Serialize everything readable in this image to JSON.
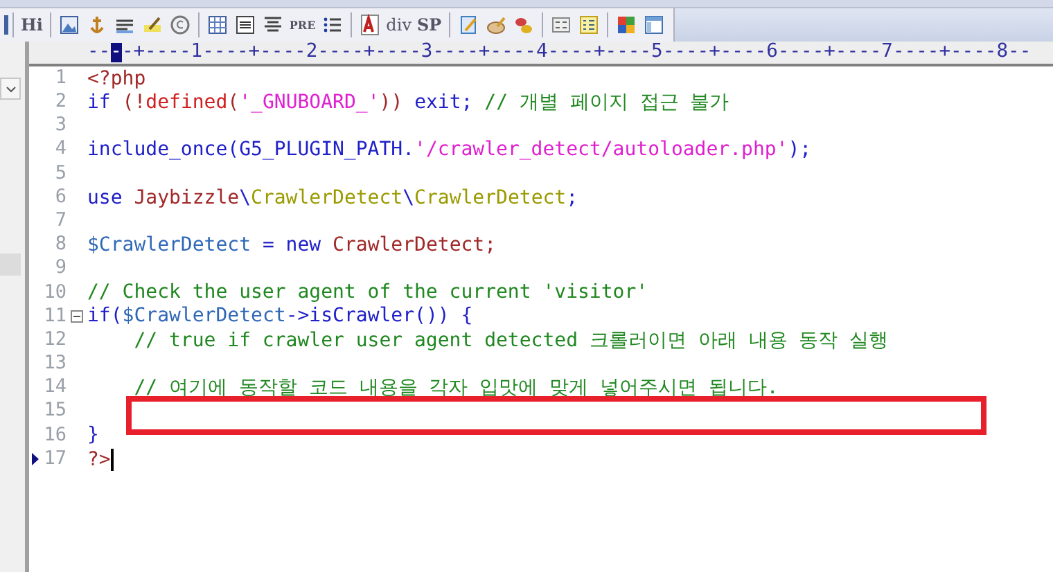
{
  "toolbar": {
    "labels": [
      "Hi",
      "PRE",
      "div",
      "SP"
    ]
  },
  "ruler": {
    "before": "--",
    "cursor": "-",
    "after": "-+----1----+----2----+----3----+----4----+----5----+----6----+----7----+----8--"
  },
  "side_panel": {
    "highlighted": true
  },
  "lines": [
    {
      "number": "1",
      "current": false,
      "fold": false,
      "highlighted": false,
      "tokens": [
        {
          "kind": "tag",
          "text": "<?php"
        }
      ]
    },
    {
      "number": "2",
      "current": false,
      "fold": false,
      "highlighted": false,
      "tokens": [
        {
          "kind": "keyword",
          "text": "if "
        },
        {
          "kind": "punct",
          "text": "(!"
        },
        {
          "kind": "func",
          "text": "defined"
        },
        {
          "kind": "punct",
          "text": "("
        },
        {
          "kind": "string",
          "text": "'_GNUBOARD_'"
        },
        {
          "kind": "punct",
          "text": ")) "
        },
        {
          "kind": "keyword",
          "text": "exit; "
        },
        {
          "kind": "comment",
          "text": "// 개별 페이지 접근 불가"
        }
      ]
    },
    {
      "number": "3",
      "current": false,
      "fold": false,
      "highlighted": false
    },
    {
      "number": "4",
      "current": false,
      "fold": false,
      "highlighted": false,
      "tokens": [
        {
          "kind": "keyword",
          "text": "include_once(G5_PLUGIN_PATH."
        },
        {
          "kind": "string",
          "text": "'/crawler_detect/autoloader.php'"
        },
        {
          "kind": "keyword",
          "text": ");"
        }
      ]
    },
    {
      "number": "5",
      "current": false,
      "fold": false,
      "highlighted": false
    },
    {
      "number": "6",
      "current": false,
      "fold": false,
      "highlighted": false,
      "tokens": [
        {
          "kind": "keyword",
          "text": "use "
        },
        {
          "kind": "class",
          "text": "Jaybizzle"
        },
        {
          "kind": "keyword",
          "text": "\\"
        },
        {
          "kind": "ns",
          "text": "CrawlerDetect"
        },
        {
          "kind": "keyword",
          "text": "\\"
        },
        {
          "kind": "ns",
          "text": "CrawlerDetect"
        },
        {
          "kind": "keyword",
          "text": ";"
        }
      ]
    },
    {
      "number": "7",
      "current": false,
      "fold": false,
      "highlighted": false
    },
    {
      "number": "8",
      "current": false,
      "fold": false,
      "highlighted": false,
      "tokens": [
        {
          "kind": "variable",
          "text": "$CrawlerDetect"
        },
        {
          "kind": "keyword",
          "text": " = new "
        },
        {
          "kind": "class",
          "text": "CrawlerDetect;"
        }
      ]
    },
    {
      "number": "9",
      "current": false,
      "fold": false,
      "highlighted": false
    },
    {
      "number": "10",
      "current": false,
      "fold": false,
      "highlighted": false,
      "tokens": [
        {
          "kind": "comment",
          "text": "// Check the user agent of the current 'visitor'"
        }
      ]
    },
    {
      "number": "11",
      "current": false,
      "fold": true,
      "highlighted": false,
      "tokens": [
        {
          "kind": "keyword",
          "text": "if("
        },
        {
          "kind": "variable",
          "text": "$CrawlerDetect"
        },
        {
          "kind": "keyword",
          "text": "->isCrawler()) {"
        }
      ]
    },
    {
      "number": "12",
      "current": false,
      "fold": false,
      "highlighted": false,
      "tokens": [
        {
          "kind": "comment",
          "text": "    // true if crawler user agent detected 크롤러이면 아래 내용 동작 실행"
        }
      ]
    },
    {
      "number": "13",
      "current": false,
      "fold": false,
      "highlighted": false
    },
    {
      "number": "14",
      "current": false,
      "fold": false,
      "highlighted": false,
      "tokens": [
        {
          "kind": "comment",
          "text": "    // 여기에 동작할 코드 내용을 각자 입맛에 맞게 넣어주시면 됩니다."
        }
      ]
    },
    {
      "number": "15",
      "current": false,
      "fold": false,
      "highlighted": true
    },
    {
      "number": "16",
      "current": false,
      "fold": false,
      "highlighted": false,
      "tokens": [
        {
          "kind": "keyword",
          "text": "}"
        }
      ]
    },
    {
      "number": "17",
      "current": true,
      "fold": false,
      "highlighted": false,
      "tokens": [
        {
          "kind": "tag",
          "text": "?>"
        }
      ]
    }
  ]
}
